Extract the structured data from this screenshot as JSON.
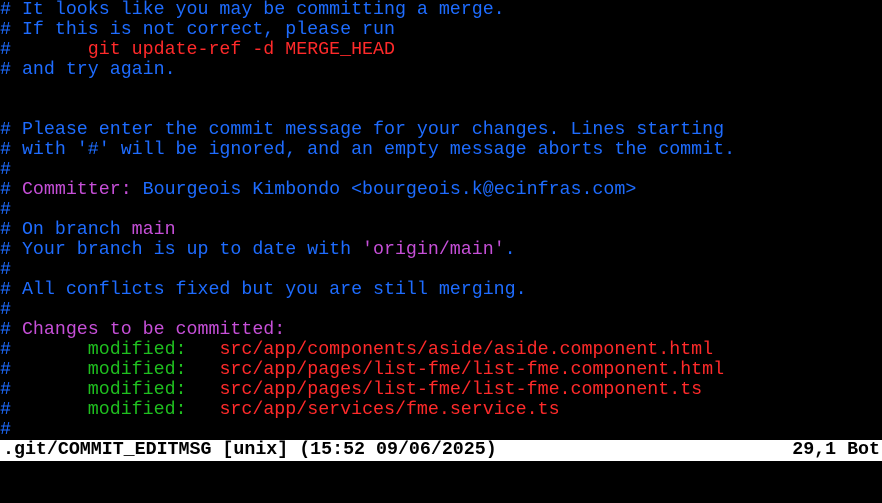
{
  "colors": {
    "comment": "#1e6cff",
    "red": "#ff2a2a",
    "magenta": "#c64fd8",
    "green": "#1fbf1f",
    "status_bg": "#ffffff",
    "status_fg": "#000000"
  },
  "lines": [
    {
      "prefix": "# ",
      "text": "It looks like you may be committing a merge."
    },
    {
      "prefix": "# ",
      "text": "If this is not correct, please run"
    },
    {
      "prefix": "# ",
      "indent": "      ",
      "text": "git update-ref -d MERGE_HEAD"
    },
    {
      "prefix": "# ",
      "text": "and try again."
    },
    {
      "text": ""
    },
    {
      "text": ""
    },
    {
      "prefix": "# ",
      "text": "Please enter the commit message for your changes. Lines starting"
    },
    {
      "prefix": "# ",
      "text": "with '#' will be ignored, and an empty message aborts the commit."
    },
    {
      "prefix": "#"
    },
    {
      "prefix": "# ",
      "label": "Committer:",
      "value": " Bourgeois Kimbondo <bourgeois.k@ecinfras.com>"
    },
    {
      "prefix": "#"
    },
    {
      "prefix": "# ",
      "text_a": "On branch ",
      "branch": "main"
    },
    {
      "prefix": "# ",
      "text_a": "Your branch is up to date with ",
      "upstream": "'origin/main'",
      "text_b": "."
    },
    {
      "prefix": "#"
    },
    {
      "prefix": "# ",
      "text": "All conflicts fixed but you are still merging."
    },
    {
      "prefix": "#"
    },
    {
      "prefix": "# ",
      "text": "Changes to be committed:"
    },
    {
      "prefix": "#",
      "indent": "       ",
      "status": "modified:",
      "gap": "   ",
      "file": "src/app/components/aside/aside.component.html"
    },
    {
      "prefix": "#",
      "indent": "       ",
      "status": "modified:",
      "gap": "   ",
      "file": "src/app/pages/list-fme/list-fme.component.html"
    },
    {
      "prefix": "#",
      "indent": "       ",
      "status": "modified:",
      "gap": "   ",
      "file": "src/app/pages/list-fme/list-fme.component.ts"
    },
    {
      "prefix": "#",
      "indent": "       ",
      "status": "modified:",
      "gap": "   ",
      "file": "src/app/services/fme.service.ts"
    },
    {
      "prefix": "#"
    }
  ],
  "statusbar": {
    "left": ".git/COMMIT_EDITMSG [unix] (15:52 09/06/2025)",
    "right": "29,1 Bot"
  }
}
